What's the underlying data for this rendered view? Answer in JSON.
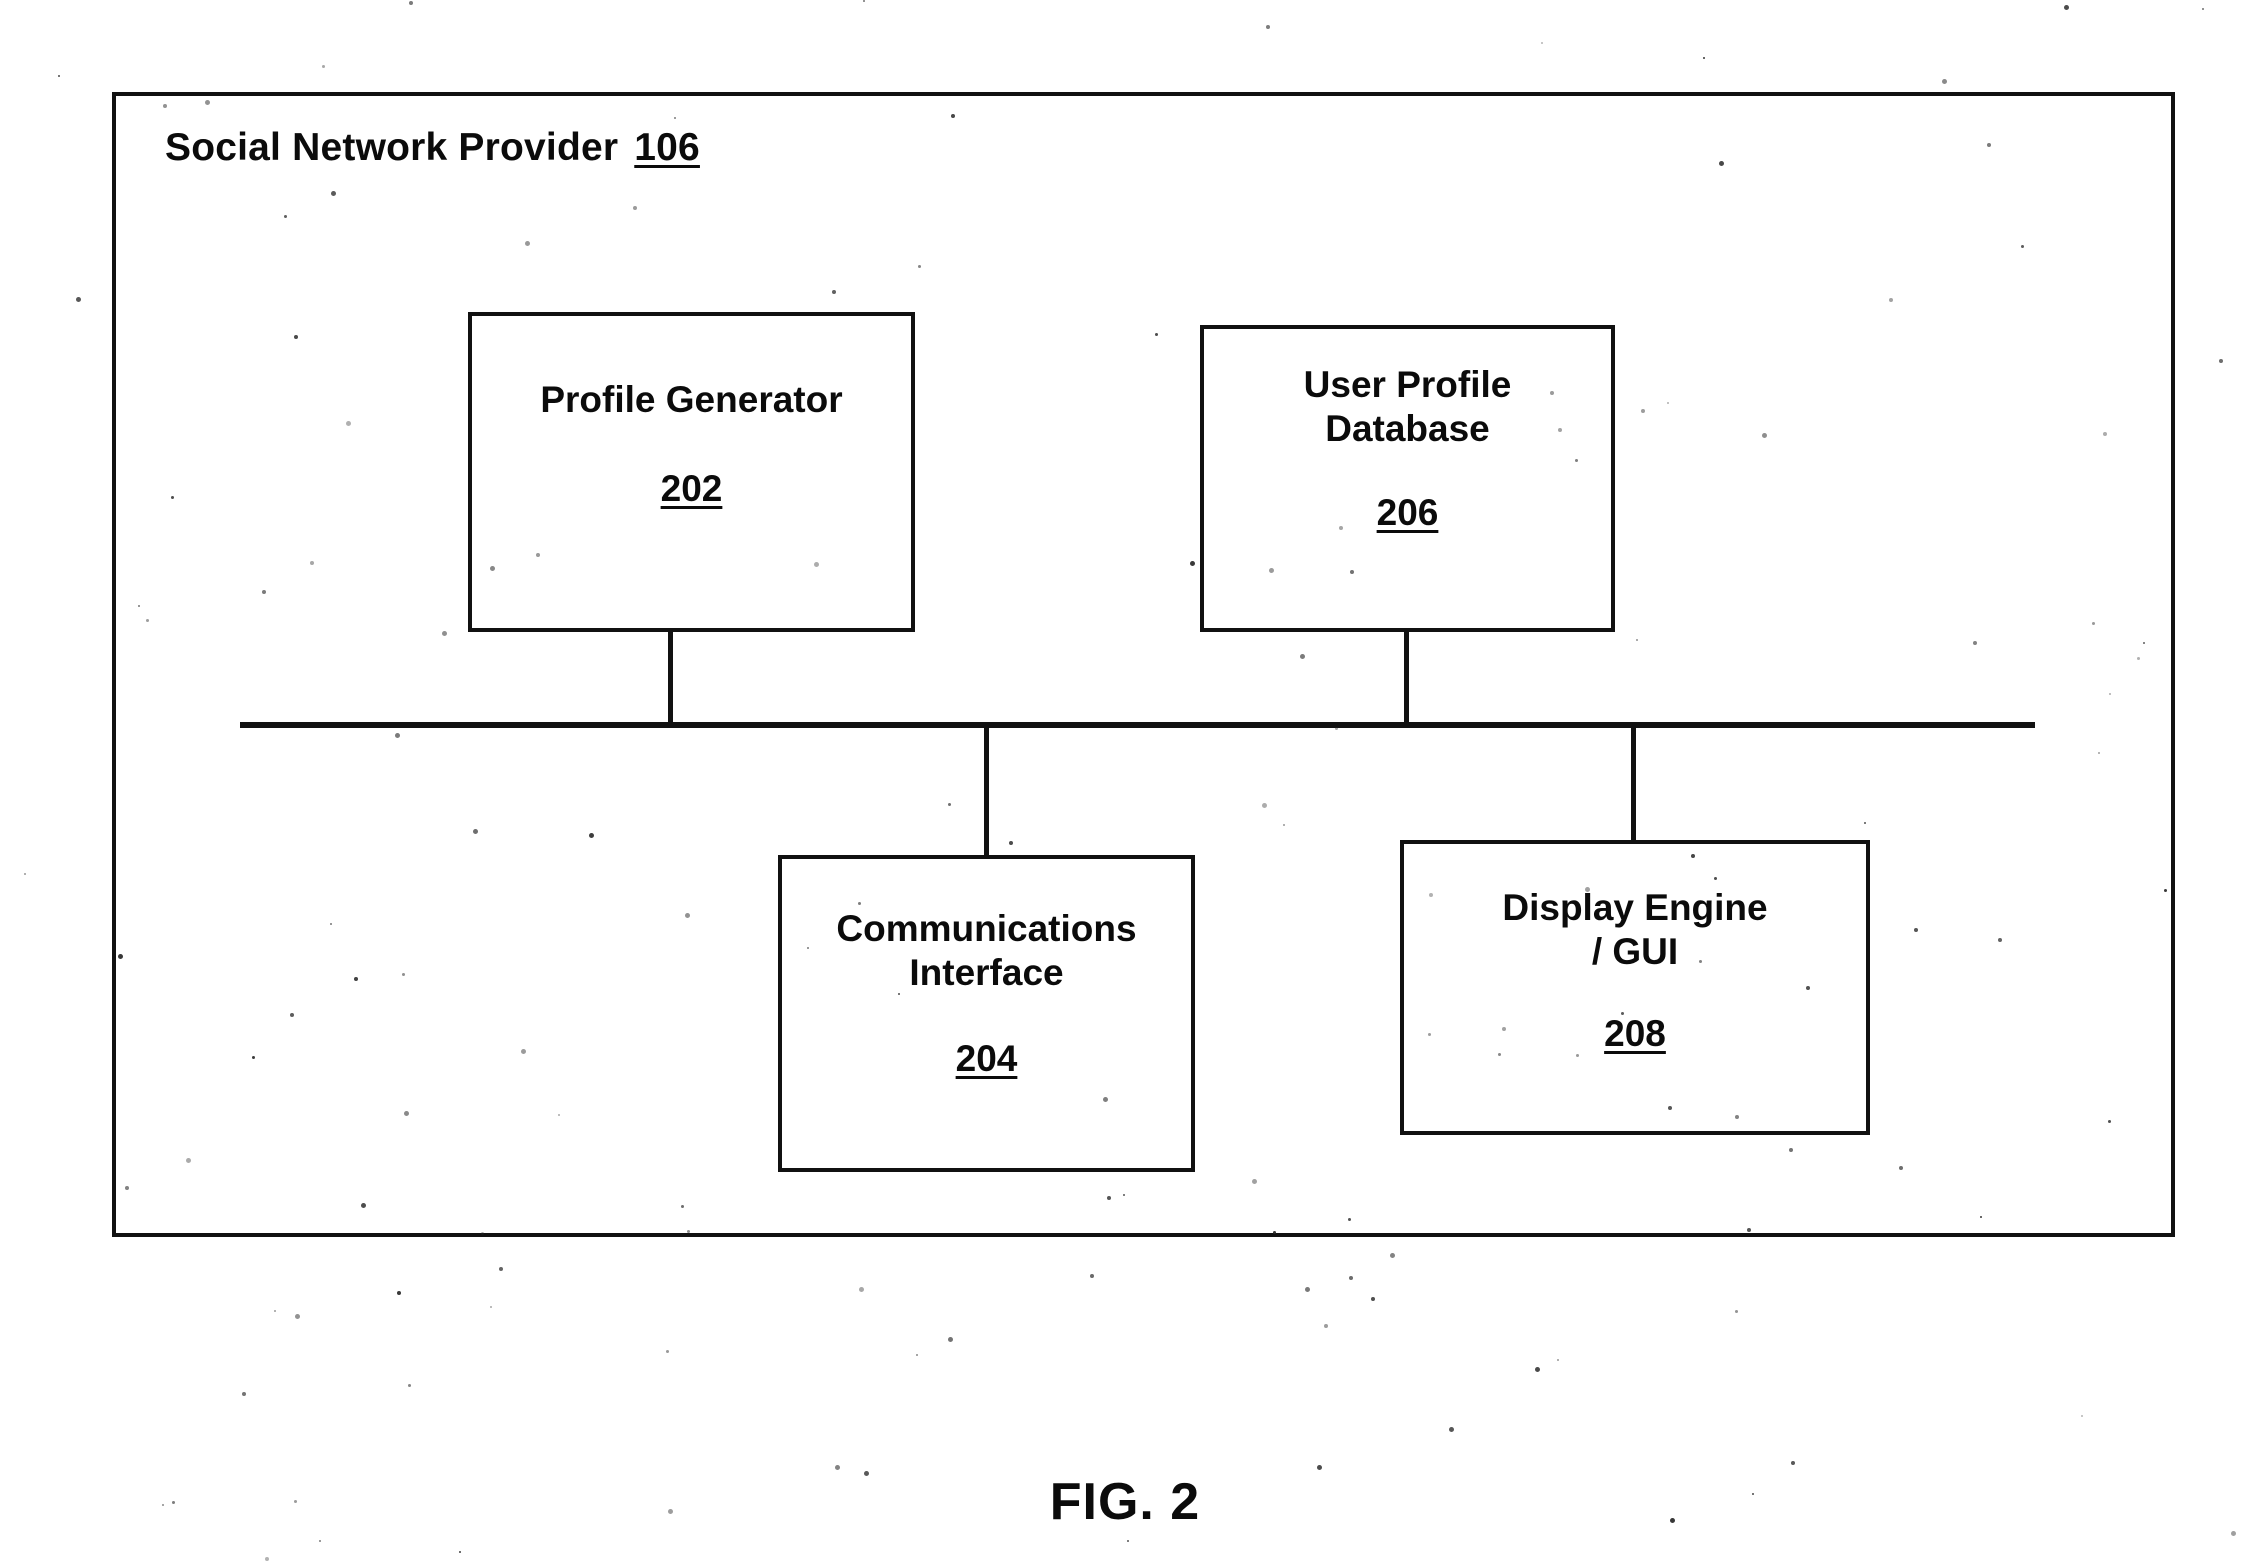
{
  "figure": {
    "caption": "FIG. 2"
  },
  "container": {
    "title_text": "Social Network Provider",
    "title_ref": "106"
  },
  "blocks": [
    {
      "id": "profile-generator",
      "label": "Profile Generator",
      "ref": "202"
    },
    {
      "id": "user-profile-database",
      "label": "User Profile\nDatabase",
      "ref": "206"
    },
    {
      "id": "communications-interface",
      "label": "Communications\nInterface",
      "ref": "204"
    },
    {
      "id": "display-engine",
      "label": "Display Engine\n/ GUI",
      "ref": "208"
    }
  ],
  "style": {
    "line_color": "#111111",
    "text_color": "#0b0b0b",
    "background": "#ffffff"
  }
}
